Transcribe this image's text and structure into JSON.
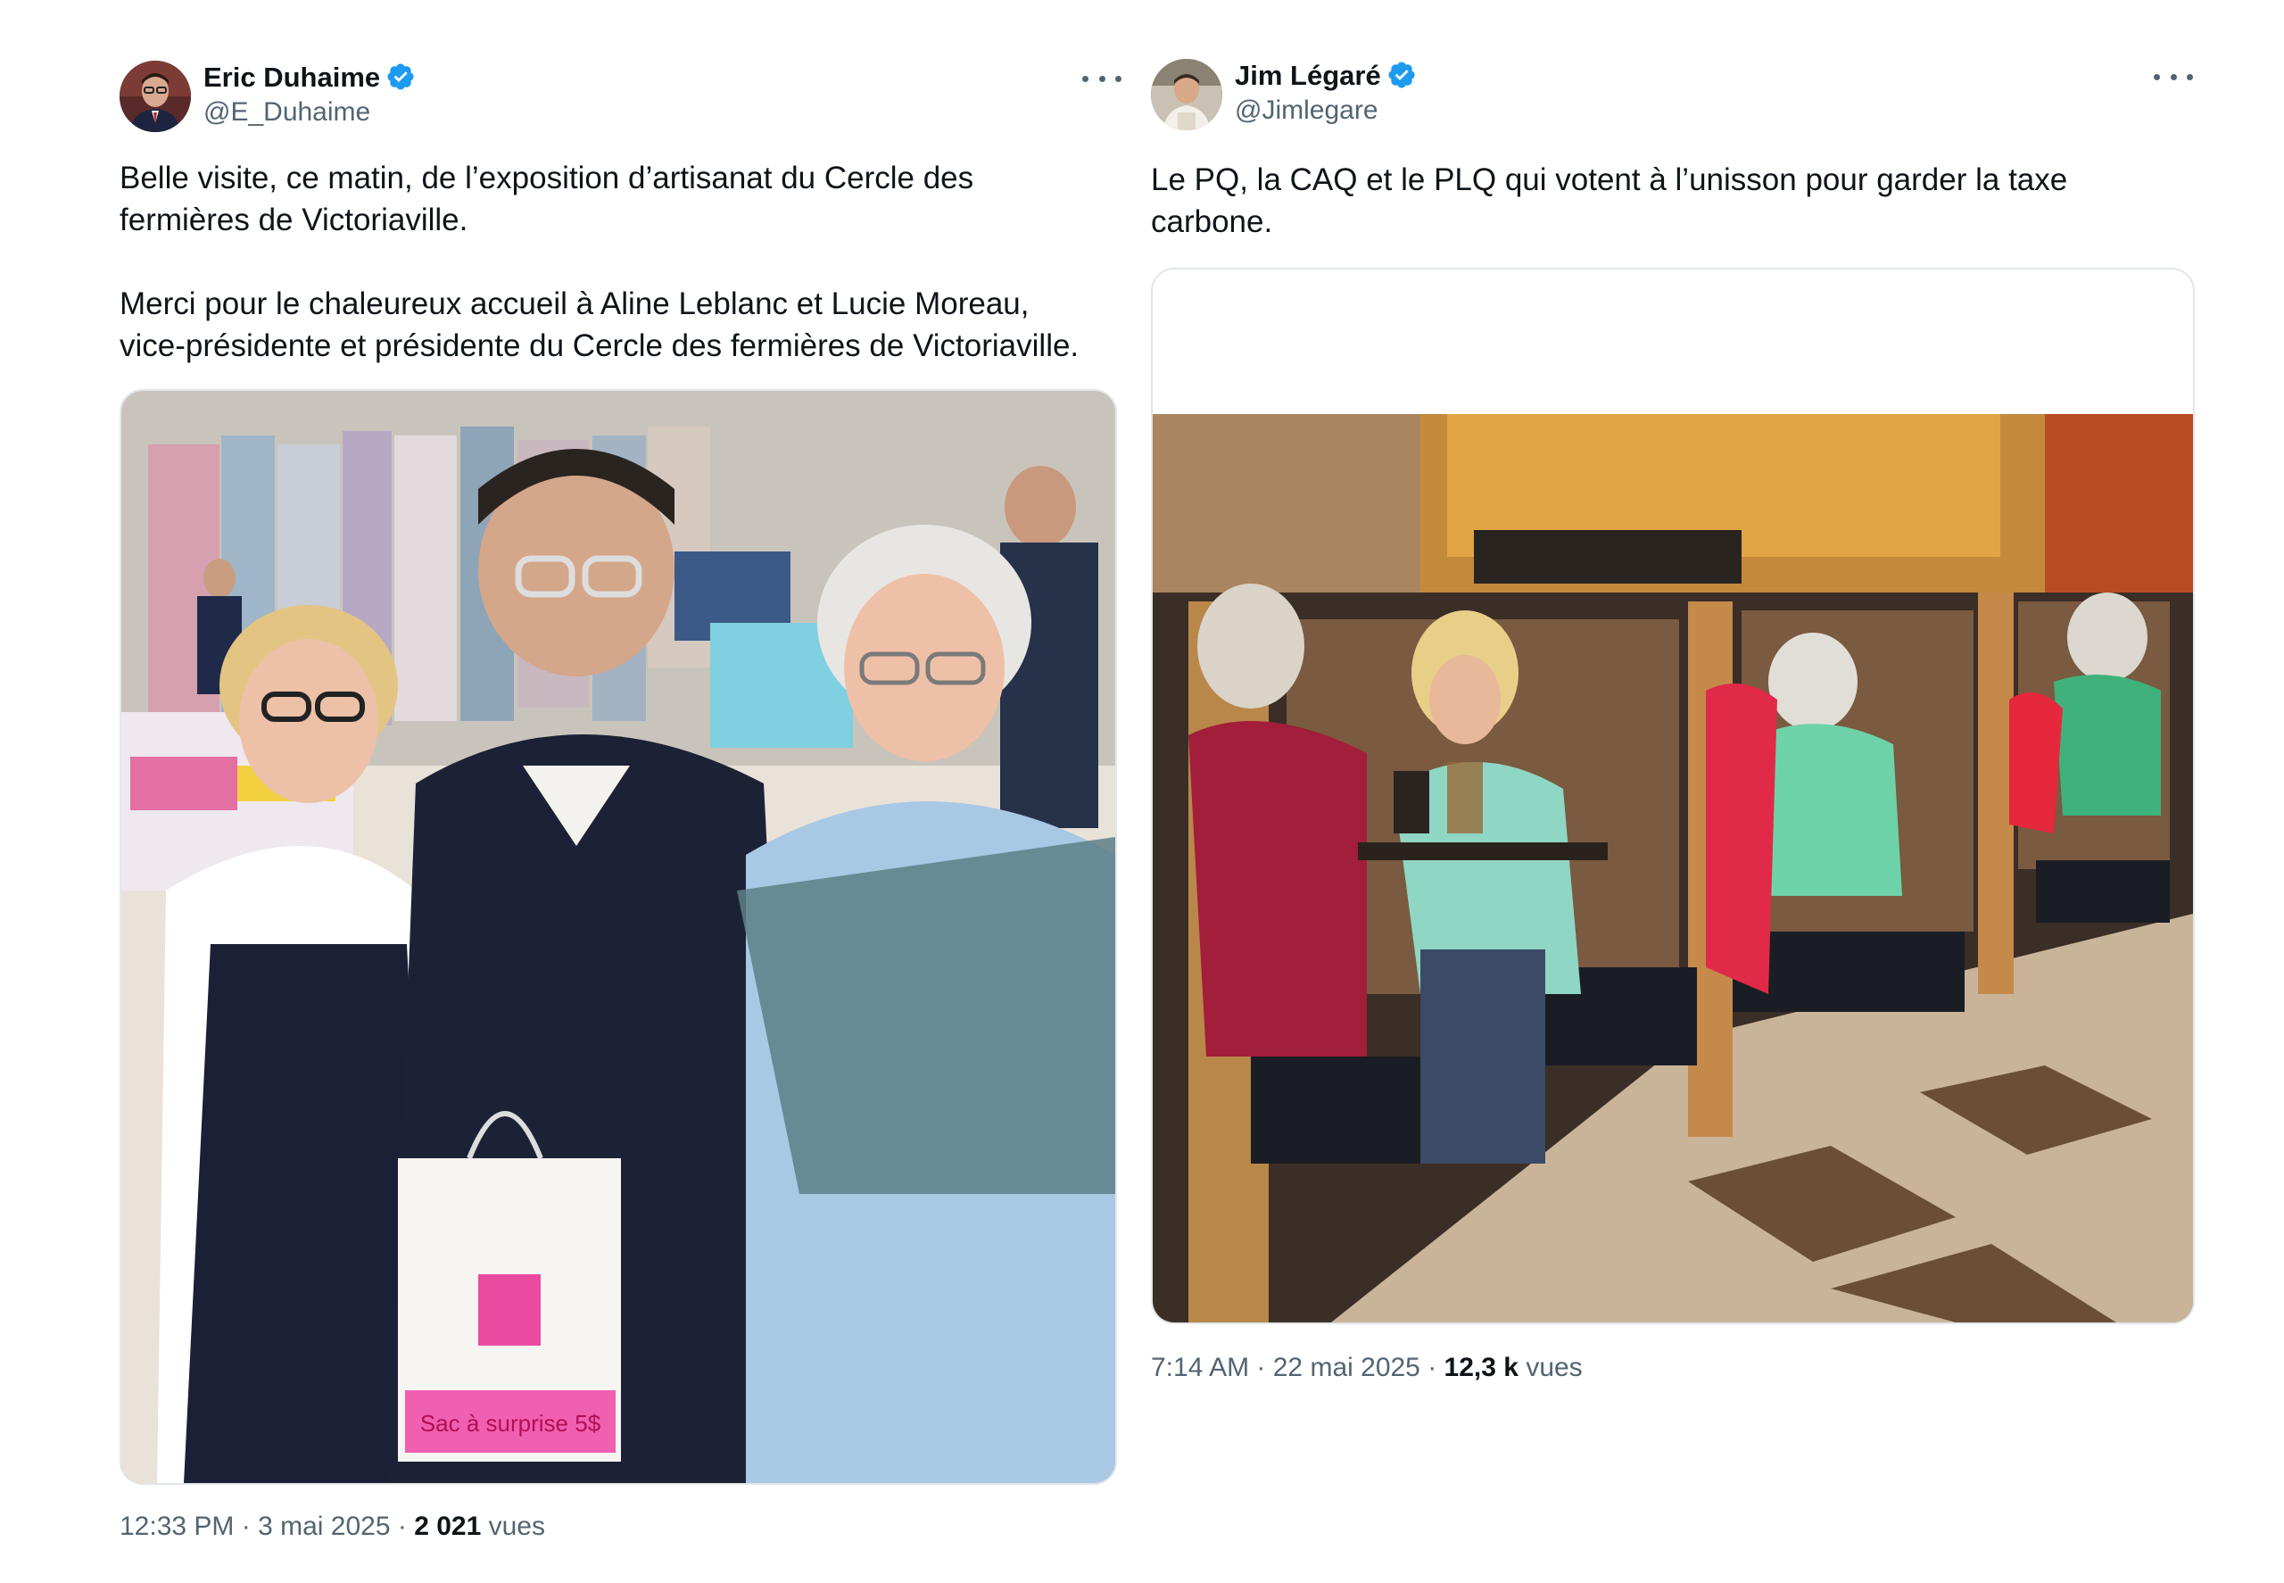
{
  "tweets": [
    {
      "author": {
        "name": "Eric Duhaime",
        "handle": "@E_Duhaime",
        "verified": true,
        "avatar_icon": "person-portrait-avatar"
      },
      "paragraphs": [
        "Belle visite, ce matin, de l’exposition d’artisanat du Cercle des fermières de Victoriaville.",
        "Merci pour le chaleureux accueil à Aline Leblanc et Lucie Moreau, vice-présidente et présidente du Cercle des fermières de Victoriaville."
      ],
      "media": {
        "type": "photo",
        "bag_text": "Sac à surprise 5$"
      },
      "time": "12:33 PM",
      "date": "3 mai 2025",
      "views_count": "2 021",
      "views_label": "vues"
    },
    {
      "author": {
        "name": "Jim Légaré",
        "handle": "@Jimlegare",
        "verified": true,
        "avatar_icon": "person-portrait-avatar"
      },
      "paragraphs": [
        "Le PQ, la CAQ et le PLQ qui votent à l’unisson pour garder la taxe carbone."
      ],
      "media": {
        "type": "photo"
      },
      "time": "7:14 AM",
      "date": "22 mai 2025",
      "views_count": "12,3 k",
      "views_label": "vues"
    }
  ],
  "separator": " · ",
  "colors": {
    "text": "#0f1419",
    "secondary": "#536471",
    "verified": "#1d9bf0",
    "border": "#e2e7ea"
  }
}
